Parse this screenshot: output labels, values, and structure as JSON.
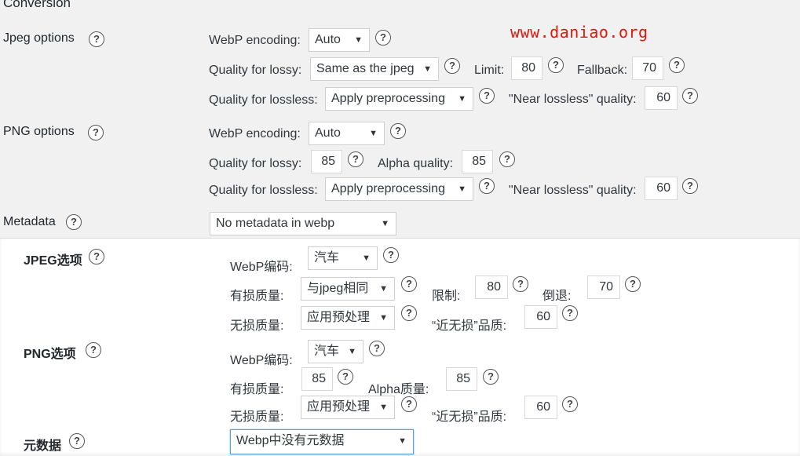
{
  "watermark": "www.daniao.org",
  "english": {
    "section_title": "Conversion",
    "jpeg": {
      "label": "Jpeg options",
      "webp_encoding_label": "WebP encoding:",
      "webp_encoding_value": "Auto",
      "lossy_label": "Quality for lossy:",
      "lossy_value": "Same as the jpeg",
      "limit_label": "Limit:",
      "limit_value": "80",
      "fallback_label": "Fallback:",
      "fallback_value": "70",
      "lossless_label": "Quality for lossless:",
      "lossless_value": "Apply preprocessing",
      "near_lossless_label": "\"Near lossless\" quality:",
      "near_lossless_value": "60"
    },
    "png": {
      "label": "PNG options",
      "webp_encoding_label": "WebP encoding:",
      "webp_encoding_value": "Auto",
      "lossy_label": "Quality for lossy:",
      "lossy_value": "85",
      "alpha_label": "Alpha quality:",
      "alpha_value": "85",
      "lossless_label": "Quality for lossless:",
      "lossless_value": "Apply preprocessing",
      "near_lossless_label": "\"Near lossless\" quality:",
      "near_lossless_value": "60"
    },
    "metadata": {
      "label": "Metadata",
      "value": "No metadata in webp"
    }
  },
  "chinese": {
    "jpeg": {
      "label": "JPEG选项",
      "webp_encoding_label": "WebP编码:",
      "webp_encoding_value": "汽车",
      "lossy_label": "有损质量:",
      "lossy_value": "与jpeg相同",
      "limit_label": "限制:",
      "limit_value": "80",
      "fallback_label": "倒退:",
      "fallback_value": "70",
      "lossless_label": "无损质量:",
      "lossless_value": "应用预处理",
      "near_lossless_label": "“近无损”品质:",
      "near_lossless_value": "60"
    },
    "png": {
      "label": "PNG选项",
      "webp_encoding_label": "WebP编码:",
      "webp_encoding_value": "汽车",
      "lossy_label": "有损质量:",
      "lossy_value": "85",
      "alpha_label": "Alpha质量:",
      "alpha_value": "85",
      "lossless_label": "无损质量:",
      "lossless_value": "应用预处理",
      "near_lossless_label": "“近无损”品质:",
      "near_lossless_value": "60"
    },
    "metadata": {
      "label": "元数据",
      "value": "Webp中没有元数据"
    }
  },
  "help_glyph": "?",
  "dropdown_arrow": "▼",
  "icons": {
    "help": "question-circle-icon",
    "dropdown": "chevron-down-icon"
  }
}
